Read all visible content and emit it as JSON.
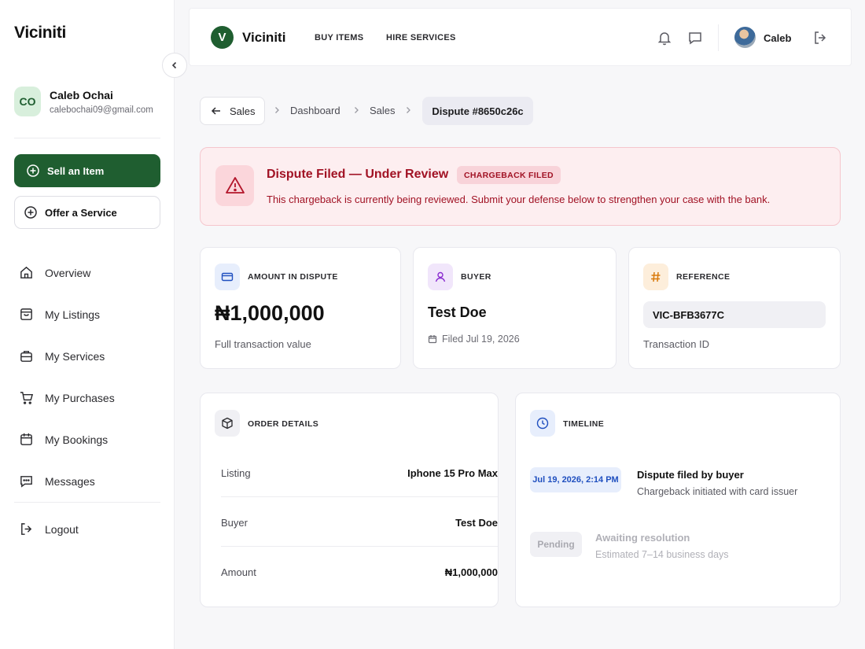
{
  "sidebar": {
    "brand": "Viciniti",
    "profile": {
      "initials": "CO",
      "name": "Caleb Ochai",
      "email": "calebochai09@gmail.com"
    },
    "sell_label": "Sell an Item",
    "offer_label": "Offer a Service",
    "nav": [
      {
        "label": "Overview",
        "icon": "home-icon"
      },
      {
        "label": "My Listings",
        "icon": "inbox-icon"
      },
      {
        "label": "My Services",
        "icon": "briefcase-icon"
      },
      {
        "label": "My Purchases",
        "icon": "cart-icon"
      },
      {
        "label": "My Bookings",
        "icon": "calendar-icon"
      },
      {
        "label": "Messages",
        "icon": "chat-icon"
      }
    ],
    "logout_label": "Logout"
  },
  "topbar": {
    "logo_letter": "V",
    "brand": "Viciniti",
    "links": [
      "BUY ITEMS",
      "HIRE SERVICES"
    ],
    "user": "Caleb"
  },
  "breadcrumb": {
    "back_label": "Sales",
    "items": [
      "Dashboard",
      "Sales"
    ],
    "current": "Dispute #8650c26c"
  },
  "alert": {
    "title": "Dispute Filed — Under Review",
    "badge": "CHARGEBACK FILED",
    "message": "This chargeback is currently being reviewed. Submit your defense below to strengthen your case with the bank.",
    "color": "#a11224"
  },
  "stats": {
    "amount": {
      "label": "AMOUNT IN DISPUTE",
      "value": "₦1,000,000",
      "sub": "Full transaction value"
    },
    "buyer": {
      "label": "BUYER",
      "name": "Test Doe",
      "filed": "Filed Jul 19, 2026"
    },
    "reference": {
      "label": "REFERENCE",
      "value": "VIC-BFB3677C",
      "sub": "Transaction ID"
    }
  },
  "order": {
    "title": "ORDER DETAILS",
    "rows": [
      {
        "label": "Listing",
        "value": "Iphone 15 Pro Max"
      },
      {
        "label": "Buyer",
        "value": "Test Doe"
      },
      {
        "label": "Amount",
        "value": "₦1,000,000"
      }
    ]
  },
  "timeline": {
    "title": "TIMELINE",
    "events": [
      {
        "date": "Jul 19, 2026, 2:14 PM",
        "title": "Dispute filed by buyer",
        "desc": "Chargeback initiated with card issuer"
      },
      {
        "date": "Pending",
        "title": "Awaiting resolution",
        "desc": "Estimated 7–14 business days"
      }
    ]
  },
  "colors": {
    "brand": "#1f5e30",
    "danger": "#a11224",
    "info": "#1f4fbf"
  }
}
